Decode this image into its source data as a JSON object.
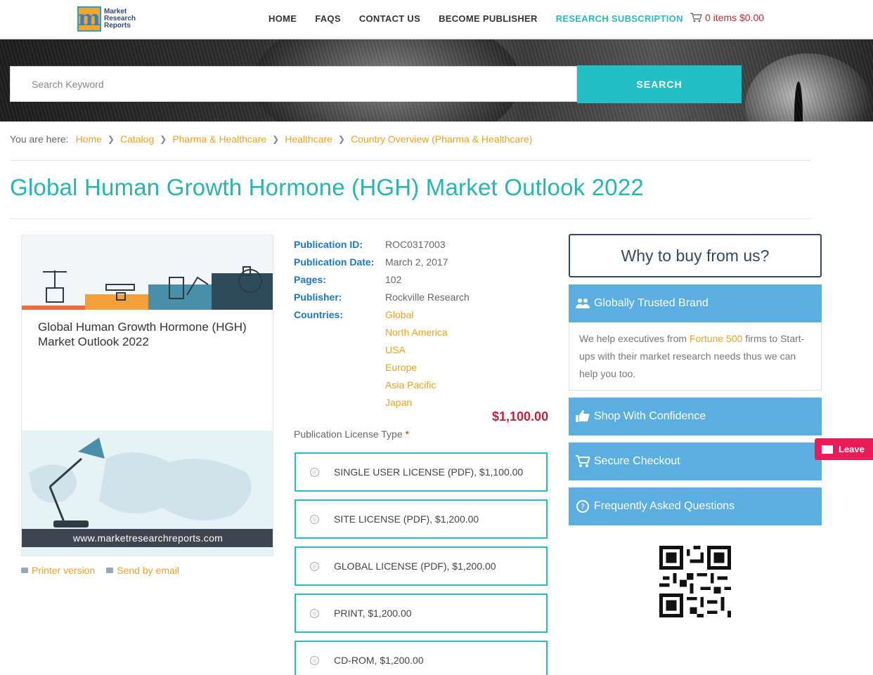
{
  "header": {
    "logo_text": [
      "Market",
      "Research",
      "Reports"
    ],
    "nav": [
      "HOME",
      "FAQS",
      "CONTACT US",
      "BECOME PUBLISHER",
      "RESEARCH SUBSCRIPTION"
    ],
    "cart": "0 items $0.00"
  },
  "search": {
    "placeholder": "Search Keyword",
    "button": "SEARCH"
  },
  "breadcrumb": {
    "label": "You are here:",
    "items": [
      "Home",
      "Catalog",
      "Pharma & Healthcare",
      "Healthcare",
      "Country Overview (Pharma & Healthcare)"
    ]
  },
  "page_title": "Global Human Growth Hormone (HGH) Market Outlook 2022",
  "cover": {
    "title": "Global Human Growth Hormone (HGH) Market Outlook 2022",
    "url": "www.marketresearchreports.com"
  },
  "links": {
    "printer": "Printer version",
    "email": "Send by email"
  },
  "details": {
    "publication_id_label": "Publication ID:",
    "publication_id": "ROC0317003",
    "date_label": "Publication Date:",
    "date": "March 2, 2017",
    "pages_label": "Pages:",
    "pages": "102",
    "publisher_label": "Publisher:",
    "publisher": "Rockville Research",
    "countries_label": "Countries:",
    "countries": [
      "Global",
      "North America",
      "USA",
      "Europe",
      "Asia Pacific",
      "Japan"
    ]
  },
  "price": "$1,100.00",
  "license": {
    "label": "Publication License Type",
    "required_mark": "*",
    "options": [
      "SINGLE USER LICENSE (PDF), $1,100.00",
      "SITE LICENSE (PDF), $1,200.00",
      "GLOBAL LICENSE (PDF), $1,200.00",
      "PRINT, $1,200.00",
      "CD-ROM, $1,200.00"
    ]
  },
  "sidebar": {
    "why": "Why to buy from us?",
    "trusted": "Globally Trusted Brand",
    "trusted_body_pre": "We help executives from ",
    "trusted_body_link": "Fortune 500",
    "trusted_body_post": " firms to Start-ups with their market research needs thus we can help you too.",
    "shop": "Shop With Confidence",
    "checkout": "Secure Checkout",
    "faq": "Frequently Asked Questions"
  },
  "leave_tab": "Leave",
  "colors": {
    "teal": "#22bfc4",
    "title_teal": "#26b5b0",
    "orange_link": "#f0a01e",
    "price_red": "#c4213a",
    "sidebar_blue": "#5aaee0",
    "label_blue": "#1a78c2"
  }
}
